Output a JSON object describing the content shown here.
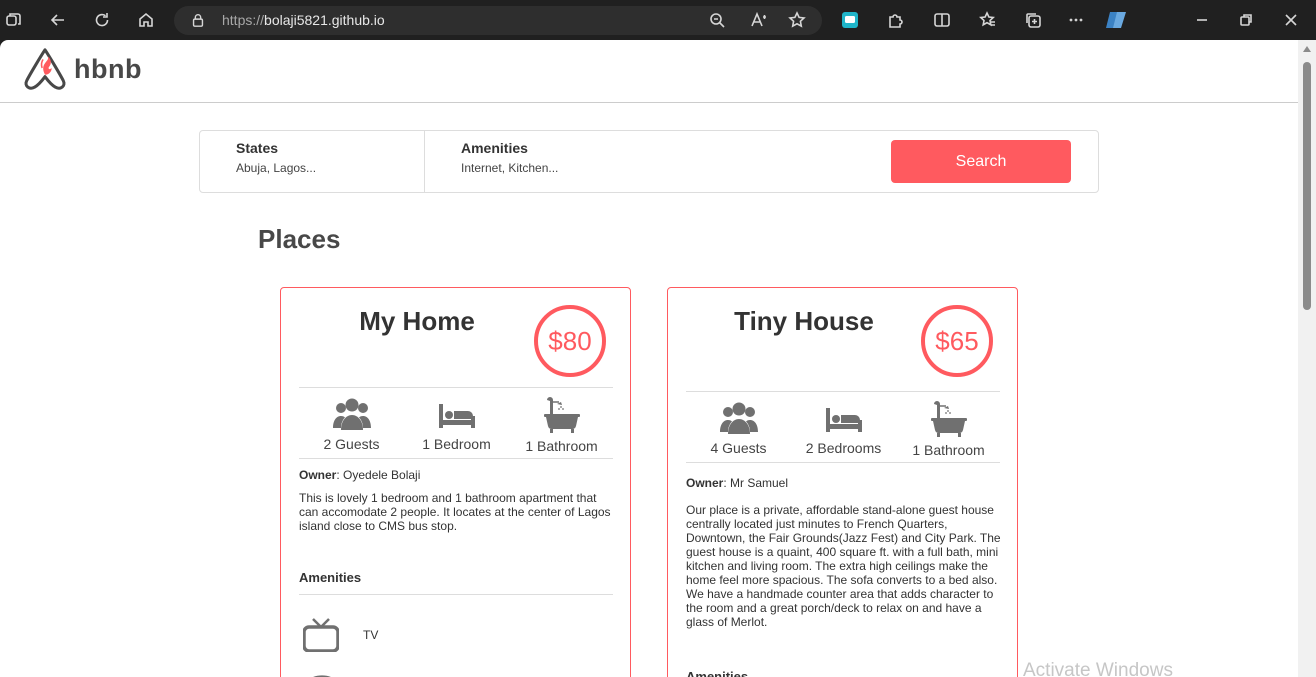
{
  "browser": {
    "url_protocol": "https://",
    "url_host": "bolaji5821.github.io"
  },
  "header": {
    "logo_text": "hbnb"
  },
  "filters": {
    "states_title": "States",
    "states_value": "Abuja, Lagos...",
    "amenities_title": "Amenities",
    "amenities_value": "Internet, Kitchen...",
    "search_label": "Search"
  },
  "places": {
    "title": "Places",
    "items": [
      {
        "title": "My Home",
        "price": "$80",
        "guests": "2 Guests",
        "bedrooms": "1 Bedroom",
        "bathrooms": "1 Bathroom",
        "owner_label": "Owner",
        "owner_name": ": Oyedele Bolaji",
        "description": "This is lovely 1 bedroom and 1 bathroom apartment that can accomodate 2 people. It locates at the center of Lagos island close to CMS bus stop.",
        "amenities_title": "Amenities",
        "amenities": [
          "TV"
        ]
      },
      {
        "title": "Tiny House",
        "price": "$65",
        "guests": "4 Guests",
        "bedrooms": "2 Bedrooms",
        "bathrooms": "1 Bathroom",
        "owner_label": "Owner",
        "owner_name": ": Mr Samuel",
        "description": "Our place is a private, affordable stand-alone guest house centrally located just minutes to French Quarters, Downtown, the Fair Grounds(Jazz Fest) and City Park. The guest house is a quaint, 400 square ft. with a full bath, mini kitchen and living room. The extra high ceilings make the home feel more spacious. The sofa converts to a bed also. We have a handmade counter area that adds character to the room and a great porch/deck to relax on and have a glass of Merlot.",
        "amenities_title": "Amenities"
      }
    ]
  },
  "os": {
    "watermark": "Activate Windows"
  },
  "colors": {
    "accent": "#ff5a5f",
    "text": "#484848",
    "icon": "#707070"
  }
}
